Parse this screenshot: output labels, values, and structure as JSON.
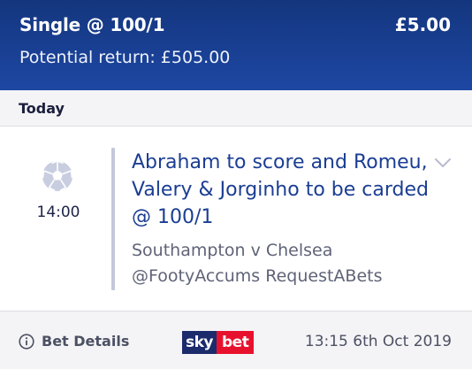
{
  "header": {
    "bet_type": "Single @ 100/1",
    "stake": "£5.00",
    "potential_return": "Potential return: £505.00",
    "background_color": "#1d47a3"
  },
  "day_bar": {
    "label": "Today"
  },
  "selection": {
    "sport_icon": "football-icon",
    "kickoff_time": "14:00",
    "name": "Abraham to score and Romeu, Valery & Jorginho to be carded @ 100/1",
    "event": "Southampton v Chelsea",
    "source": "@FootyAccums RequestABets",
    "expand_icon": "chevron-down-icon"
  },
  "footer": {
    "details_icon": "info-icon",
    "details_label": "Bet Details",
    "logo_sky": "sky",
    "logo_bet": "bet",
    "timestamp": "13:15 6th Oct 2019"
  }
}
